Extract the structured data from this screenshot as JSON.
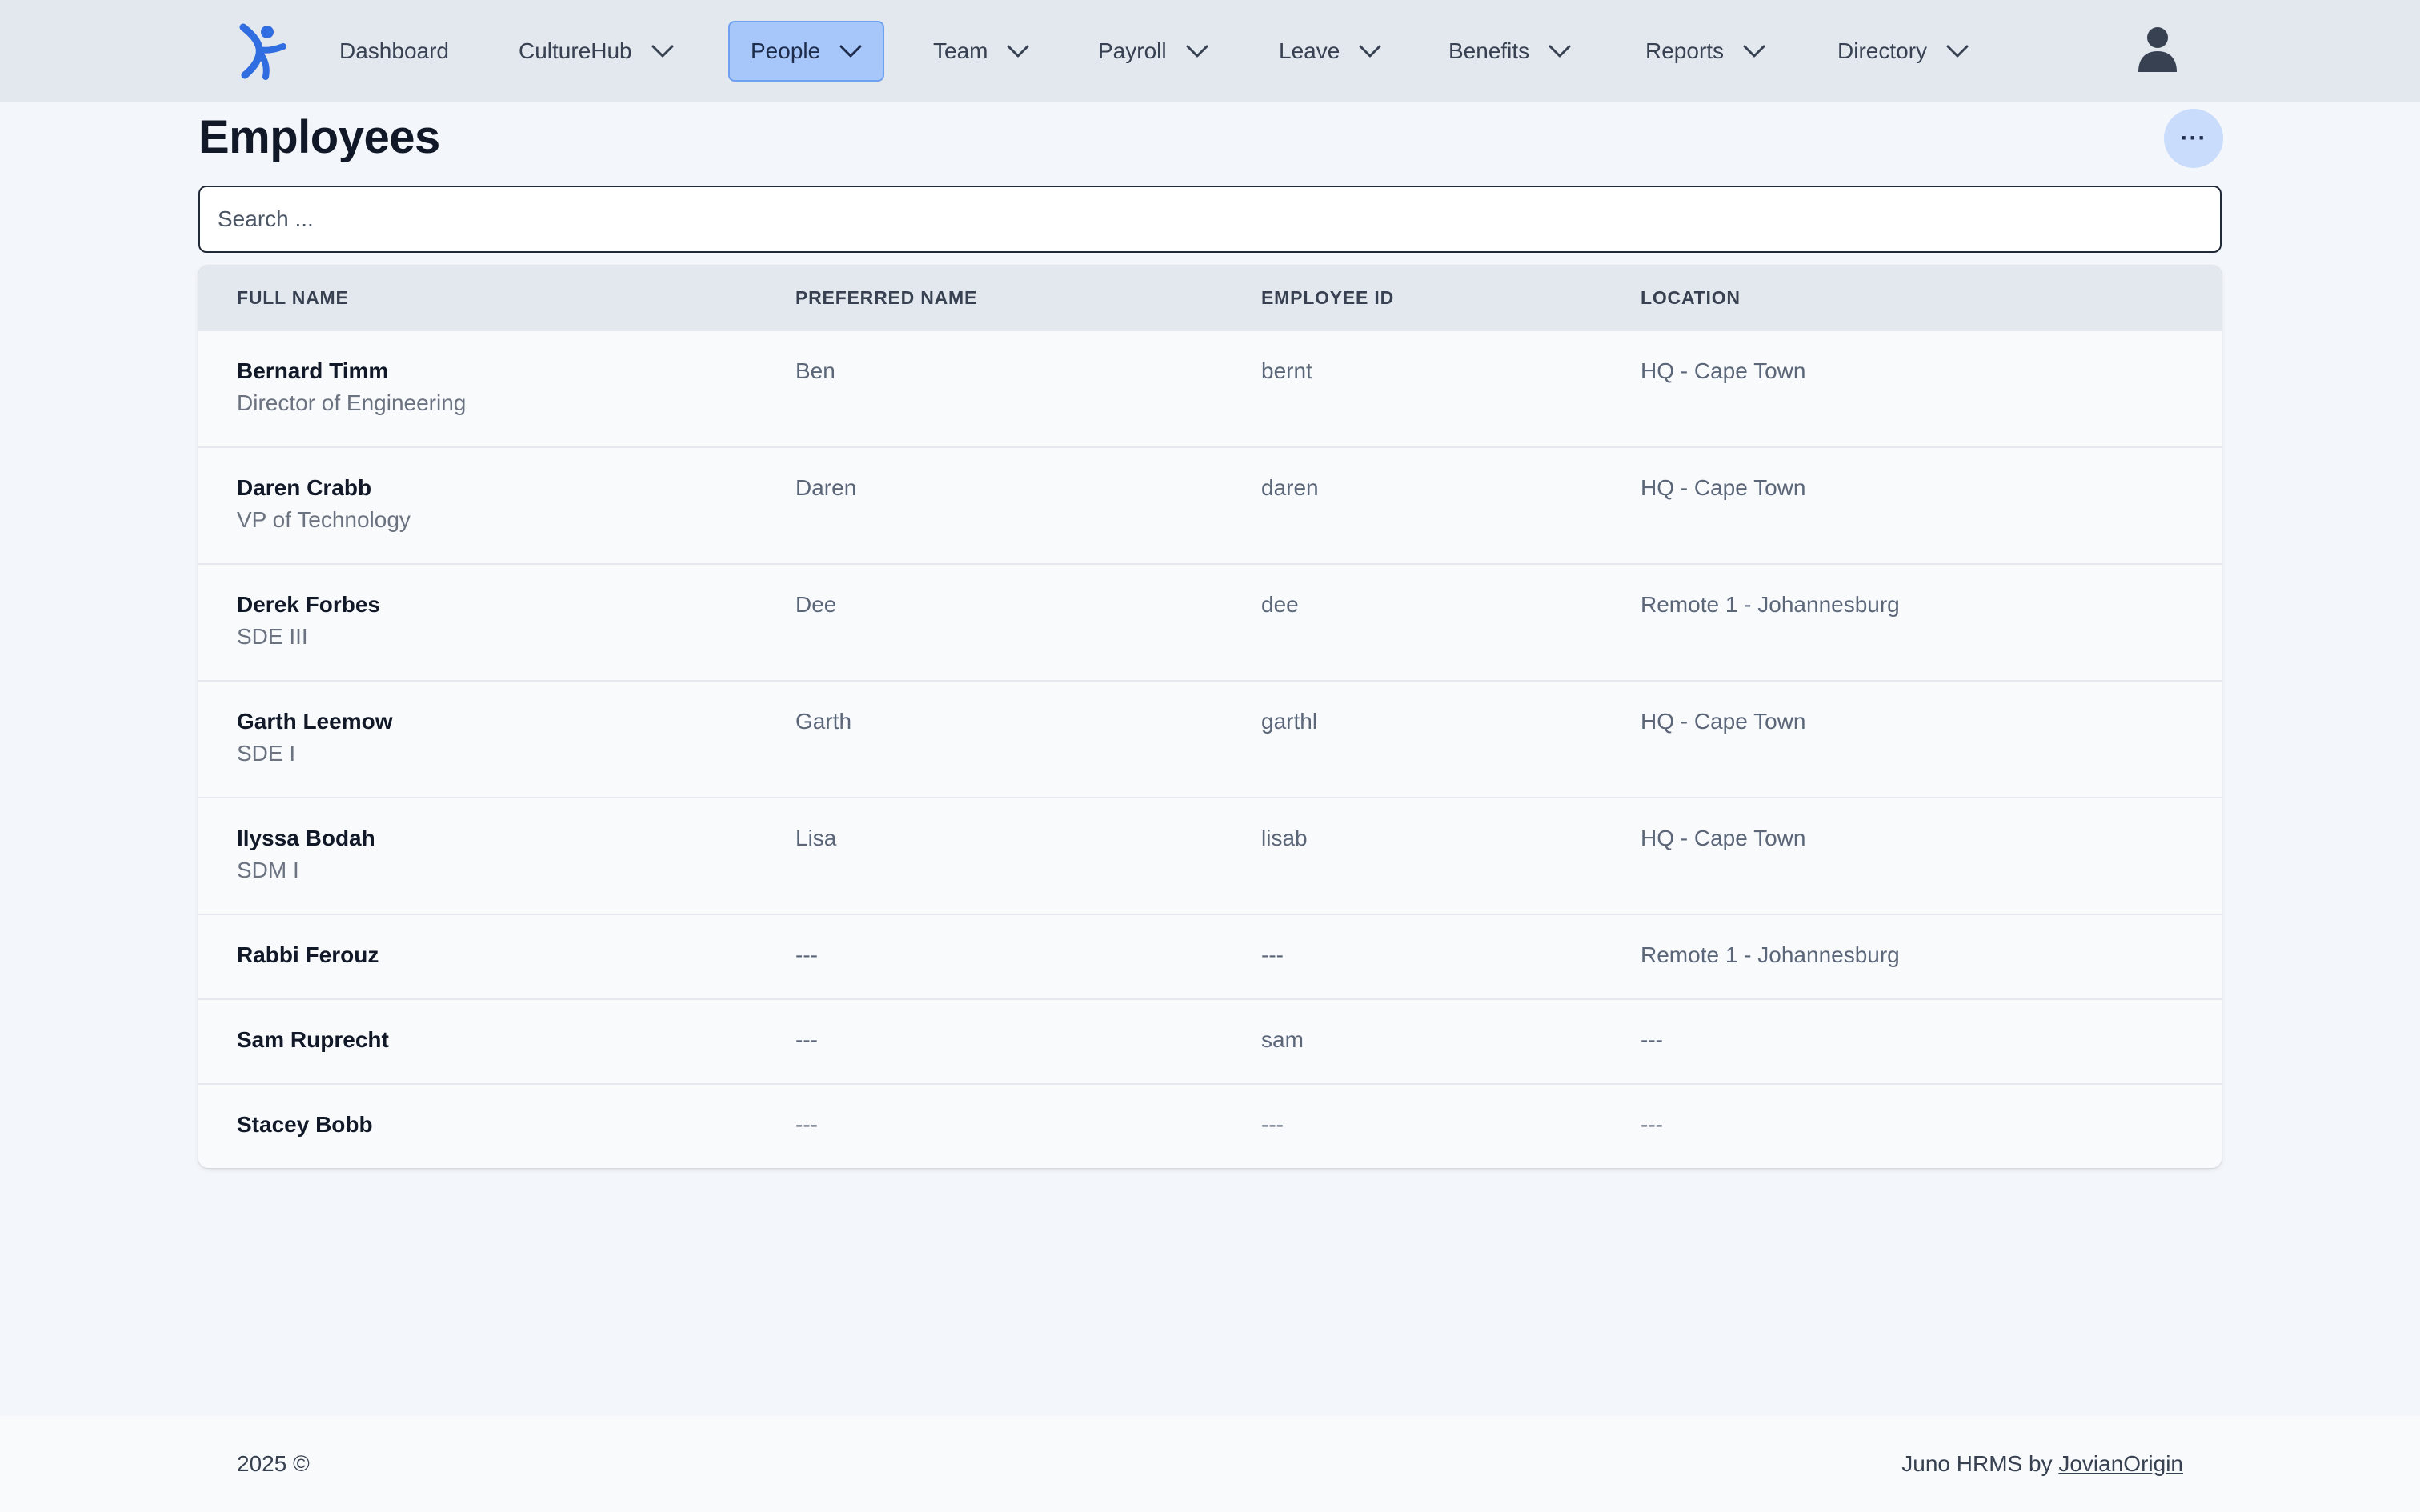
{
  "nav": {
    "logo_icon": "juno-logo-icon",
    "items": [
      {
        "label": "Dashboard",
        "dropdown": false
      },
      {
        "label": "CultureHub",
        "dropdown": true
      },
      {
        "label": "People",
        "dropdown": true,
        "active": true
      },
      {
        "label": "Team",
        "dropdown": true
      },
      {
        "label": "Payroll",
        "dropdown": true
      },
      {
        "label": "Leave",
        "dropdown": true
      },
      {
        "label": "Benefits",
        "dropdown": true
      },
      {
        "label": "Reports",
        "dropdown": true
      },
      {
        "label": "Directory",
        "dropdown": true
      }
    ],
    "avatar_icon": "user-icon",
    "active_color": "#a7c7fb"
  },
  "page": {
    "title": "Employees",
    "more_label": "···"
  },
  "search": {
    "placeholder": "Search ...",
    "value": ""
  },
  "table": {
    "headers": [
      "FULL NAME",
      "PREFERRED NAME",
      "EMPLOYEE ID",
      "LOCATION"
    ],
    "rows": [
      {
        "name": "Bernard Timm",
        "title": "Director of Engineering",
        "preferred": "Ben",
        "id": "bernt",
        "location": "HQ - Cape Town"
      },
      {
        "name": "Daren Crabb",
        "title": "VP of Technology",
        "preferred": "Daren",
        "id": "daren",
        "location": "HQ - Cape Town"
      },
      {
        "name": "Derek Forbes",
        "title": "SDE III",
        "preferred": "Dee",
        "id": "dee",
        "location": "Remote 1 - Johannesburg"
      },
      {
        "name": "Garth Leemow",
        "title": "SDE I",
        "preferred": "Garth",
        "id": "garthl",
        "location": "HQ - Cape Town"
      },
      {
        "name": "Ilyssa Bodah",
        "title": "SDM I",
        "preferred": "Lisa",
        "id": "lisab",
        "location": "HQ - Cape Town"
      },
      {
        "name": "Rabbi Ferouz",
        "title": "",
        "preferred": "---",
        "id": "---",
        "location": "Remote 1 - Johannesburg"
      },
      {
        "name": "Sam Ruprecht",
        "title": "",
        "preferred": "---",
        "id": "sam",
        "location": "---"
      },
      {
        "name": "Stacey Bobb",
        "title": "",
        "preferred": "---",
        "id": "---",
        "location": "---"
      }
    ]
  },
  "footer": {
    "year": "2025 ©",
    "credit_prefix": "Juno HRMS by",
    "credit_link": "JovianOrigin"
  }
}
